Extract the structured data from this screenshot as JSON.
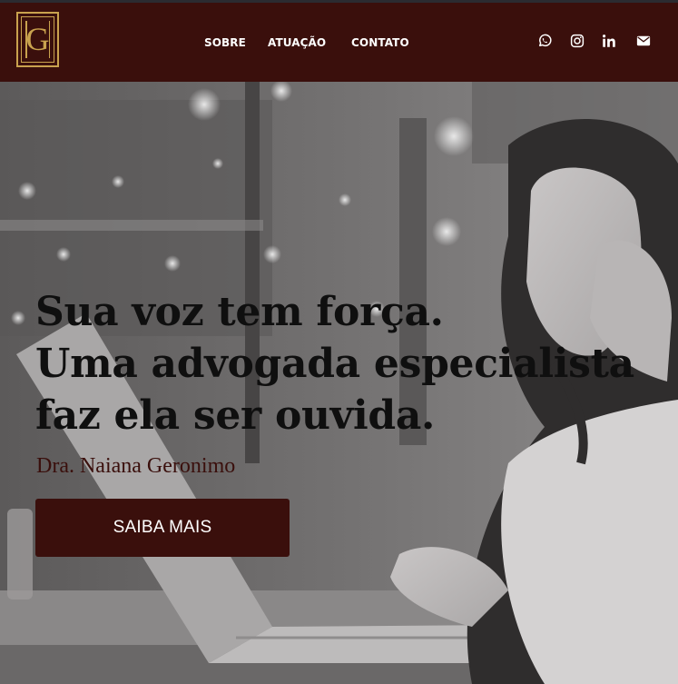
{
  "brand": {
    "logo_letter": "G"
  },
  "nav": {
    "items": [
      {
        "label": "SOBRE"
      },
      {
        "label": "ATUAÇÃO"
      },
      {
        "label": "CONTATO"
      }
    ]
  },
  "social": [
    "whatsapp-icon",
    "instagram-icon",
    "linkedin-icon",
    "email-icon"
  ],
  "hero": {
    "headline": [
      "Sua voz tem força.",
      "Uma advogada especialista",
      "faz ela ser ouvida."
    ],
    "subtitle": "Dra. Naiana Geronimo",
    "cta_label": "SAIBA MAIS"
  },
  "colors": {
    "brand": "#3a0f0c",
    "accent_gold": "#c9a24e",
    "text_dark": "#0f0f0f"
  }
}
